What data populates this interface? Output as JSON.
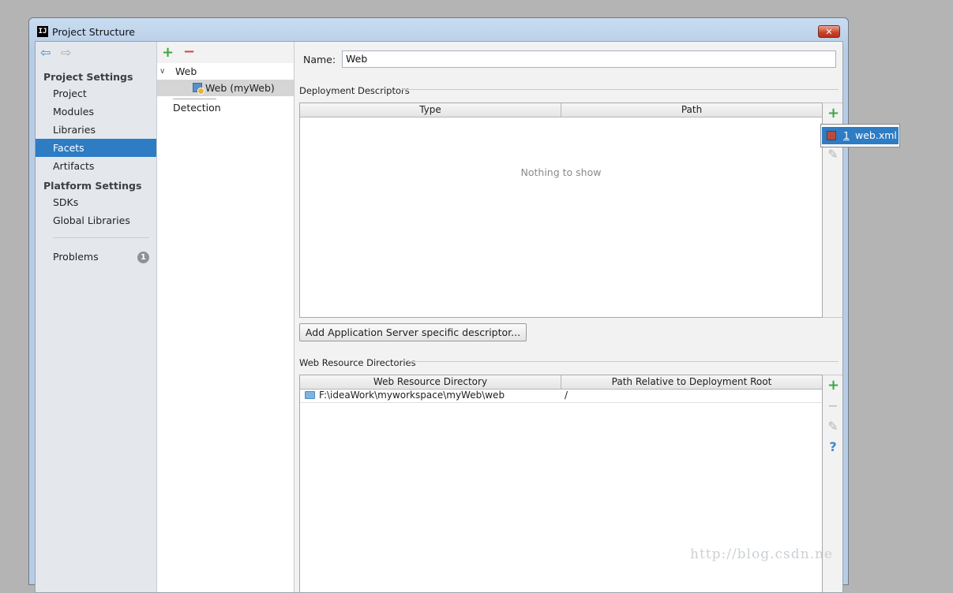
{
  "window": {
    "title": "Project Structure",
    "app_icon_text": "IJ",
    "close_glyph": "✕"
  },
  "nav": {
    "back_glyph": "⇦",
    "forward_glyph": "⇨",
    "project_settings_header": "Project Settings",
    "project_settings_items": [
      "Project",
      "Modules",
      "Libraries",
      "Facets",
      "Artifacts"
    ],
    "selected_item": "Facets",
    "platform_settings_header": "Platform Settings",
    "platform_settings_items": [
      "SDKs",
      "Global Libraries"
    ],
    "problems_label": "Problems",
    "problems_count": "1"
  },
  "facets_tree": {
    "add_glyph": "+",
    "remove_glyph": "−",
    "expand_glyph": "∨",
    "root": "Web",
    "child": "Web (myWeb)",
    "detection": "Detection"
  },
  "main": {
    "name_label": "Name:",
    "name_value": "Web",
    "deployment_descriptors": {
      "title": "Deployment Descriptors",
      "col_type": "Type",
      "col_path": "Path",
      "empty_text": "Nothing to show",
      "add_glyph": "+",
      "edit_glyph": "✎"
    },
    "popup": {
      "index": "1",
      "item": "web.xml"
    },
    "server_button": "Add Application Server specific descriptor...",
    "web_resource_directories": {
      "title": "Web Resource Directories",
      "col_directory": "Web Resource Directory",
      "col_relative": "Path Relative to Deployment Root",
      "rows": [
        {
          "directory": "F:\\ideaWork\\myworkspace\\myWeb\\web",
          "relative": "/"
        }
      ],
      "add_glyph": "+",
      "remove_glyph": "−",
      "edit_glyph": "✎",
      "help_glyph": "?"
    }
  },
  "watermark": "http://blog.csdn.ne",
  "colors": {
    "selection": "#2d7cc4",
    "add_green": "#3fa644",
    "remove_red": "#d64b3d"
  }
}
